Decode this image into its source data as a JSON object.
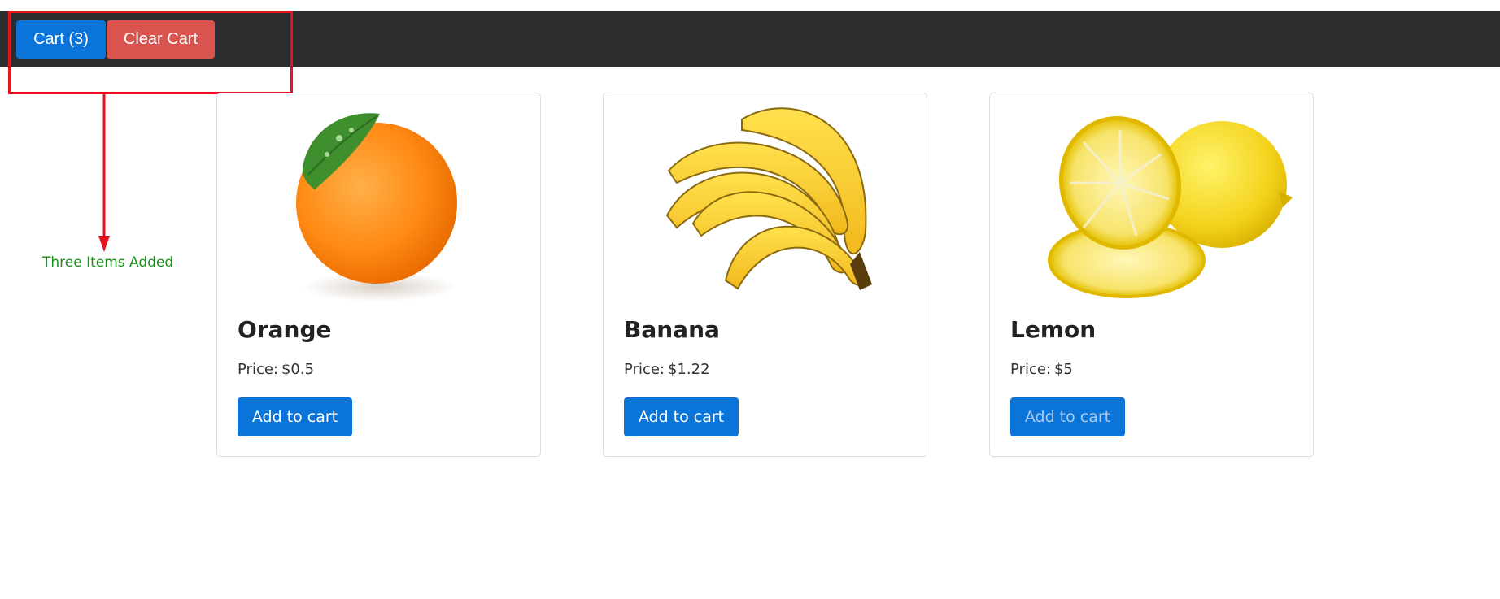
{
  "navbar": {
    "cart_label": "Cart (3)",
    "clear_label": "Clear Cart"
  },
  "annotation": {
    "text": "Three Items Added",
    "color": "#1a8f1a",
    "highlight_color": "#e8121e"
  },
  "products": [
    {
      "name": "Orange",
      "price_label": "Price:",
      "price": "$0.5",
      "button": "Add to cart",
      "image": "orange-image"
    },
    {
      "name": "Banana",
      "price_label": "Price:",
      "price": "$1.22",
      "button": "Add to cart",
      "image": "banana-image"
    },
    {
      "name": "Lemon",
      "price_label": "Price:",
      "price": "$5",
      "button": "Add to cart",
      "image": "lemon-image"
    }
  ],
  "colors": {
    "navbar_bg": "#2b2c2e",
    "primary": "#0a74d9",
    "danger": "#d9534f"
  }
}
